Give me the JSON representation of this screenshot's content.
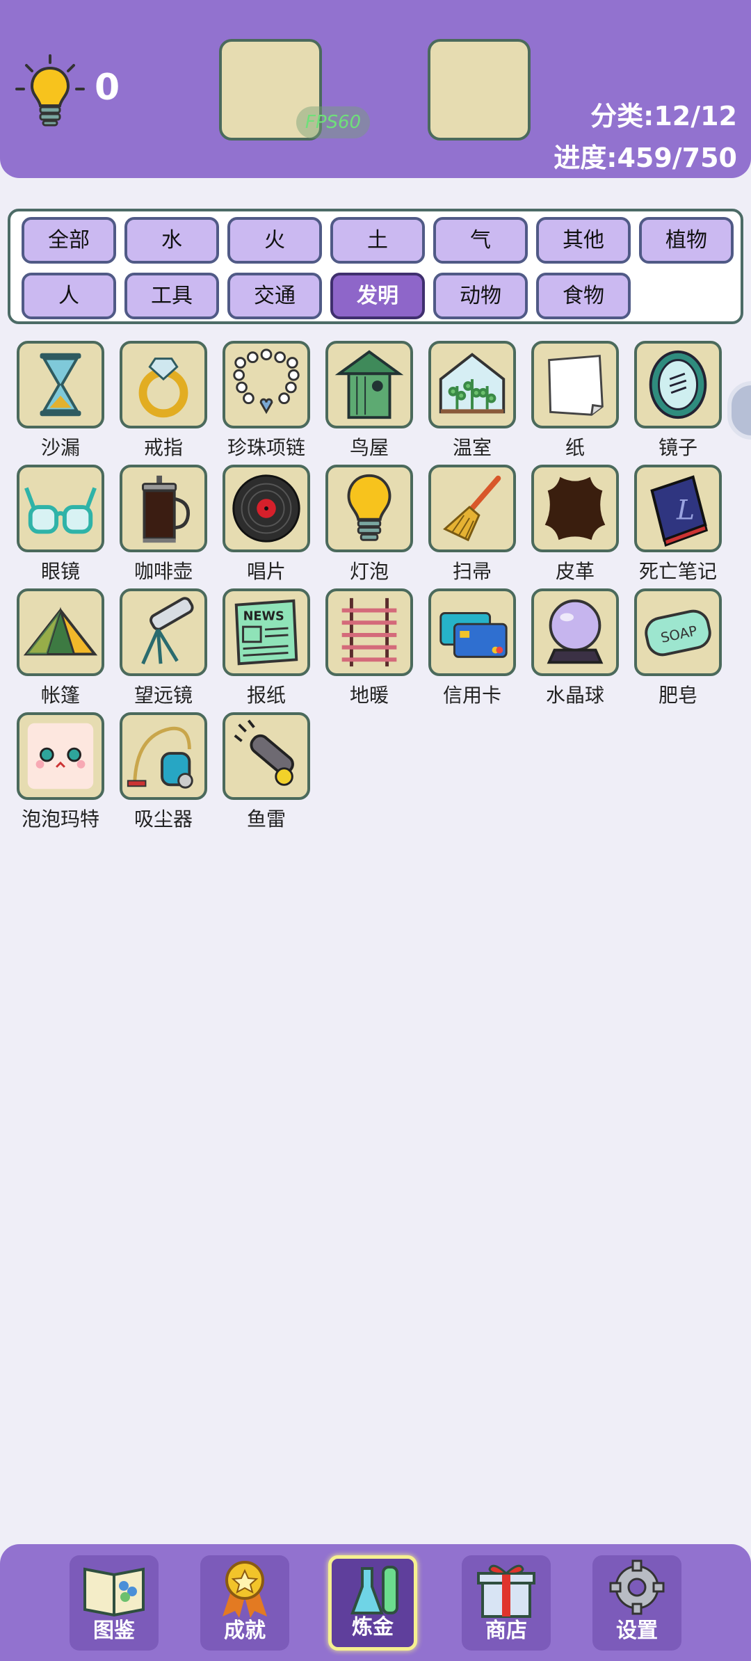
{
  "header": {
    "hint_count": "0",
    "fps": "FPS60",
    "category_label": "分类:12/12",
    "progress_label": "进度:459/750"
  },
  "filters": [
    "全部",
    "水",
    "火",
    "土",
    "气",
    "其他",
    "植物",
    "人",
    "工具",
    "交通",
    "发明",
    "动物",
    "食物"
  ],
  "active_filter": "发明",
  "items": [
    "沙漏",
    "戒指",
    "珍珠项链",
    "鸟屋",
    "温室",
    "纸",
    "镜子",
    "眼镜",
    "咖啡壶",
    "唱片",
    "灯泡",
    "扫帚",
    "皮革",
    "死亡笔记",
    "帐篷",
    "望远镜",
    "报纸",
    "地暖",
    "信用卡",
    "水晶球",
    "肥皂",
    "泡泡玛特",
    "吸尘器",
    "鱼雷"
  ],
  "item_icons": [
    "hourglass-icon",
    "ring-icon",
    "pearl-necklace-icon",
    "birdhouse-icon",
    "greenhouse-icon",
    "paper-icon",
    "mirror-icon",
    "glasses-icon",
    "coffee-pot-icon",
    "record-icon",
    "lightbulb-icon",
    "broom-icon",
    "leather-icon",
    "death-note-icon",
    "tent-icon",
    "telescope-icon",
    "newspaper-icon",
    "floor-heating-icon",
    "credit-card-icon",
    "crystal-ball-icon",
    "soap-icon",
    "popmart-icon",
    "vacuum-icon",
    "torpedo-icon"
  ],
  "icon_text": {
    "newspaper": "NEWS",
    "soap": "SOAP",
    "death_note": "L"
  },
  "nav": [
    "图鉴",
    "成就",
    "炼金",
    "商店",
    "设置"
  ],
  "active_nav": "炼金",
  "colors": {
    "purple": "#9272cf",
    "tile": "#e6dcb1",
    "tile_border": "#4b6a5c",
    "chip": "#cbb9f1",
    "chip_active": "#8e66c9"
  }
}
